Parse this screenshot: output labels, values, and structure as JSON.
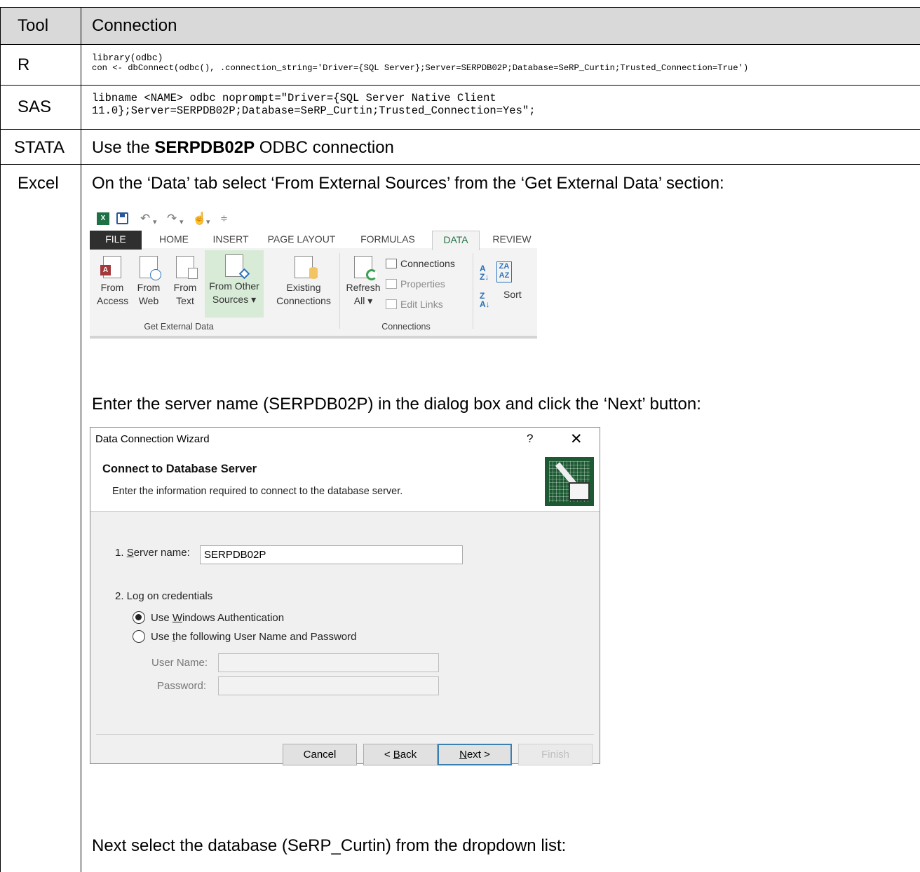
{
  "table": {
    "headers": {
      "tool": "Tool",
      "connection": "Connection"
    },
    "rows": [
      {
        "tool": "R",
        "code_lines": [
          "library(odbc)",
          "con <- dbConnect(odbc(), .connection_string='Driver={SQL Server};Server=SERPDB02P;Database=SeRP_Curtin;Trusted_Connection=True')"
        ]
      },
      {
        "tool": "SAS",
        "code_lines": [
          "libname <NAME> odbc noprompt=\"Driver={SQL Server Native Client",
          "11.0};Server=SERPDB02P;Database=SeRP_Curtin;Trusted_Connection=Yes\";"
        ]
      },
      {
        "tool": "STATA",
        "text_before": "Use the ",
        "text_bold": "SERPDB02P",
        "text_after": " ODBC connection"
      },
      {
        "tool": "Excel",
        "step1": "On the ‘Data’ tab select ‘From External Sources’ from the ‘Get External Data’ section:",
        "step2": "Enter the server name (SERPDB02P) in the dialog box and click the ‘Next’ button:",
        "step3": "Next select the database (SeRP_Curtin) from the  dropdown list:"
      }
    ]
  },
  "ribbon": {
    "qat_icons": [
      "excel-logo",
      "save",
      "undo",
      "redo",
      "touch-mode",
      "customize"
    ],
    "tabs": [
      "FILE",
      "HOME",
      "INSERT",
      "PAGE LAYOUT",
      "FORMULAS",
      "DATA",
      "REVIEW"
    ],
    "active_tab": "DATA",
    "get_external_data": {
      "label": "Get External Data",
      "buttons": [
        {
          "line1": "From",
          "line2": "Access"
        },
        {
          "line1": "From",
          "line2": "Web"
        },
        {
          "line1": "From",
          "line2": "Text"
        },
        {
          "line1": "From Other",
          "line2": "Sources ▾"
        }
      ]
    },
    "existing": {
      "line1": "Existing",
      "line2": "Connections"
    },
    "connections_group": {
      "label": "Connections",
      "refresh": {
        "line1": "Refresh",
        "line2": "All ▾"
      },
      "connections": "Connections",
      "properties": "Properties",
      "edit_links": "Edit Links"
    },
    "sort": "Sort"
  },
  "dialog": {
    "title": "Data Connection Wizard",
    "help": "?",
    "close": "✕",
    "heading": "Connect to Database Server",
    "subheading": "Enter the information required to connect to the database server.",
    "server_label_prefix": "1. ",
    "server_label_accel": "S",
    "server_label_rest": "erver name:",
    "server_value": "SERPDB02P",
    "credentials_label": "2. Log on credentials",
    "radio1_prefix": "Use ",
    "radio1_accel": "W",
    "radio1_rest": "indows Authentication",
    "radio2_prefix": "Use ",
    "radio2_accel": "t",
    "radio2_rest": "he following User Name and Password",
    "username_label": "User Name:",
    "password_label": "Password:",
    "buttons": {
      "cancel": "Cancel",
      "back_prefix": "< ",
      "back_accel": "B",
      "back_rest": "ack",
      "next_accel": "N",
      "next_rest": "ext >",
      "finish": "Finish"
    }
  }
}
